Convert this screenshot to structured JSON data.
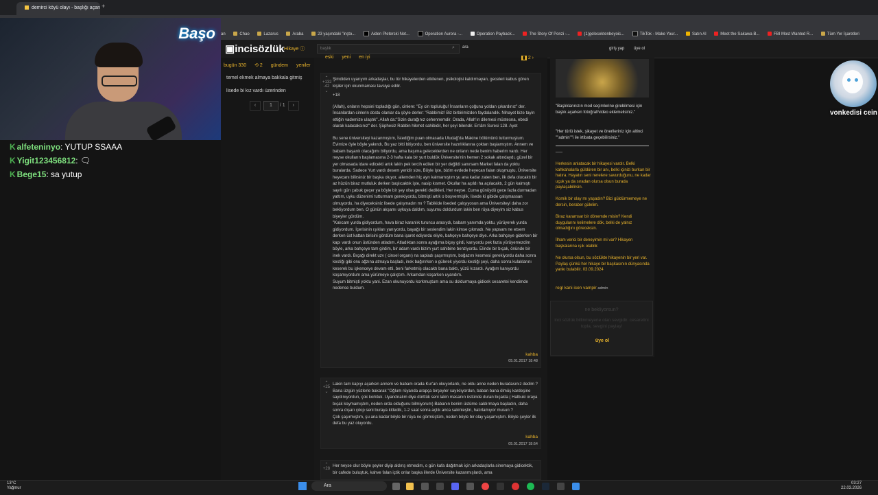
{
  "browser": {
    "tab_title": "demirci köyü olayı - başlığı açan",
    "new_tab": "+",
    "bookmarks": [
      "an",
      "Chao",
      "Lazarus",
      "Araba",
      "23 yaşındaki \"inşto...",
      "Aiden Pleterski Net...",
      "Operation Aurora -...",
      "Operation Payback...",
      "The Story Of Ponzi -...",
      "(1)gelecektenbeyoic...",
      "TikTok - Make Your...",
      "Satın Al",
      "Meet the Sakawa B...",
      "FBI Most Wanted R...",
      "Tüm Yer İşaretleri"
    ]
  },
  "stream": {
    "logo": "Başo",
    "chat": [
      {
        "user": "alfeteninyo",
        "message": "YUTUP SSAAA"
      },
      {
        "user": "Yigit123456812",
        "message": "🗨"
      },
      {
        "user": "Bege15",
        "message": "sa yutup"
      }
    ],
    "cat_name": "vonkedisi cein"
  },
  "site": {
    "logo": "incisözlük",
    "hikaye": "Hikaye",
    "search_placeholder": "başlık",
    "ara": "ara",
    "giris_yap": "giriş yap",
    "uye_ol": "üye ol",
    "nav": {
      "bugun": "bugün 330",
      "refresh": "⟲ 2",
      "gundem": "gündem",
      "yeniler": "yeniler"
    },
    "topics": [
      "temel ekmek almaya bakkala gitmiş",
      "lisede bi kız vardı üzerinden"
    ],
    "pager": {
      "prev": "‹",
      "page": "1",
      "of": "/ 1",
      "next": "›"
    },
    "sort_tabs": [
      "eski",
      "yeni",
      "en iyi"
    ],
    "page_indicator": "2"
  },
  "entries": [
    {
      "votes": "+132",
      "votes2": "-42",
      "paragraphs": [
        "Şimdiden uyarıyım arkadaşlar, bu tür hikayelerden etkilenen, psikolojisi kaldırmayan, geceleri kabus gören kişiler için okunmaması tavsiye edilir.",
        "+18",
        "(Allah), onların hepsini topladığı gün, cinlere: \"Ey cin topluluğu! İnsanların çoğunu yoldan çıkardınız\" der. İnsanlardan cinlerin dostu olanlar da şöyle derler: \"Rabbimiz! Biz birbirimizden faydalandık. Nihayet bize tayin ettiğin vademize ulaştık\". Allah da:\"Sizin durağınız cehennemdir. Orada, Allah'ın dilemesi müstesna, ebedi olarak kalacaksınız\" der. Şüphesiz Rabbin hikmet sahibidir, her şeyi bilendir. En'âm Suresi 128. Ayet",
        "Bu sene üniversiteyi kazanmıştım, İstediğim puan olmasada Uludağ'da Makine bölümünü tutturmuştum. Evimize öyle böyle yakındı, Bu yaz bitti bitiyordu, ben üniversite hazırlıklarına çoktan başlamıştım. Annem ve babam başarılı olacağımı biliyordu, ama başıma geleceklerden ne onların nede benim haberim vardı. Her neyse okulların başlamasına 2-3 hafta kala bir yurt buldük Üniversite'nin hemen 2 sokak altındaydı, güzel bir yer olmasada idare edicekti artık lakin pek tercih edilen bir yer değildi sanırsam Market falan da yoktu buralarda. Sadece Yurt vardı desem yeridir size, Böyle işte, bizim evdede heyecan falan oluşmuştu, Üniversite heyecanı bilirsiniz bir başka oluyor, ailemden hiç ayrı kalmamıştım şu ana kadar zaten ben, ilk defa olucaktı bir az hüzün biraz mutluluk derken başlıcaktık işte, nasip kısmet. Okullar ha açıldı ha açılacaktı, 2 gün kalmıştı sayılı gün çabuk geçer ya böyle bir şey olsa gerekti dedikleri, Her neyse. Cuma günüydü gece fazla durmadan yattım, uyku düzenimi tutturmam gerekiyordu, bitmişti artık o boşvermişlik, lisede ki gibide çalışmassan olmuyordu, ha diyeceksiniz lisede çalışmadın mı ? Tabikide liseded çalışıyosun ama Üniversiteyi daha zor bekliyordum ben. O günün akşamı uykuya daldım, suyumu doldurdum lakin ben rüya diyeyim siz kabus biyeyler gördüm.",
        "\"Kalıcam yurda gidiyordum, hava biraz karanlık turuncu arasıydı, babam yanımda yoktu, yürüyerek yurda gidiyordum. İçerisinin ışıkları yanıyordu, bayağı bir seslendim lakin kimse çıkmadı. Ne yapsam ne etsem derken üst kattan birisini gördüm bana işaret ediyordu eliyle, bahçeye bahçeye diye. Arka bahçeye giderken bir kapı vardı onun üstünden atladım. Atladıktan sonra ayağıma biçey girdi, karıyordu pek fazla yürüyemezdim böyle, arka bahçeye tam girdim, bir adam vardı bizim yurt sahibine benziyordu. Elinde bir bıçak, önünde bir inek vardı. Bıçağı direkt uzv ( cinsel organı) na sapladı şaşırmıştım, boğazını kesmesi gerekiyordu daha sonra kestiği gibi onu ağzına atmaya başladı, inek bağırırken o gülerek yiyordu kestiği şeyi, daha sonra kulaklarını keserek bu işkenceye devam etti, beni farketmiş olacaktı bana baktı, yüzü kızardı. Ayağım kanıyordu koşamıyordum ama yürümeye çalıştım. Arkamdan koşarken uyandım.",
        "Suyum bitmişti yoktu yani. Ezan okunuyordu korkmuştum ama su doldurmaya gidicek cesaretei kendimde nedense buldum."
      ],
      "author": "kahba",
      "date": "05.01.2017 18:48"
    },
    {
      "votes": "+25",
      "paragraphs": [
        "Lakin tam kapıyı açarken annem ve babam orada Kur'an okuyorlardı, ne oldu anne neden buradasınız dedim ? Bana üzgün yüzlerle bakarak \"Oğlum rüyanda arapça birşeyler sayıklıyordun, baban bana ölmüş kardeşine saydınıyordun, çok korktuk. Uyandıralım diye dürttük seni lakin masanın üstünde duran bıçakla ( Halbuki oraya bıçak koymamıştım, neden orda olduğunu bilmiyorum) Babanın benim üstüme saldırmaya başladın, daha sonra dışarı çıkıp seni buraya kitledik, 1-2 saat sonra açtık anca sakinleştin, hatırlamıyor musun ?",
        "Çok şaşırmıştım, şu ana kadar böyle bir rüya ne görmüştüm, neden böyle bir olay yaşamıştım. Böyle şeyler ilk defa bu yaz oluyordu."
      ],
      "author": "kahba",
      "date": "05.01.2017 18:54"
    },
    {
      "votes": "+28",
      "paragraphs": [
        "Her neyse olur böyle şeyler diyip aldırış etmedim, o gün kafa dağıtmak için arkadaşlarla sinemaya gidicektik, bir cafede buluştuk, kahve falan içtik onlar başka illerde Üniversite kazanmışlardı, ama"
      ]
    }
  ],
  "sidebar": {
    "p1": "\"Başlıklarınızın mod seçimlerine girebilmesi için başlık açarken fotoğraf/video eklemelisiniz.\"",
    "p2": "\"Her türlü istek, şikayet ve önerileriniz için altinci \"\"admin\"\"i ile irtibata geçebilirsiniz.\"",
    "dash": "___",
    "y1": "Herkesin anlatacak bir hikayesi vardır. Belki kahkahalarla güldüren bir anı, belki içinizi burkan bir hatıra. Hayatın seni nerelere savurduğunu, ne kadar uçuk ya da sıradan olursa olsun burada paylaşabilirsin.",
    "y2": "Komik bir olay mı yaşadın? Bizi güldürmemeye ne dersin, beraber gülelim.",
    "y3": "Biraz karamsar bir dönemde misin? Kendi duygularını kelimelere dök, belki de yalnız olmadığını göreceksin.",
    "y4": "İlham verici bir deneyimin mi var? Hikayen başkalarına ışık olabilir.",
    "y5": "Ne olursa olsun, bu sözlükte hikayenin bir yeri var. Paylaş çünkü her hikaye bir başkasının dünyasında yankı bulabilir. 03.09.2024",
    "regl": "regl kani icen vampir",
    "admin": "admin",
    "signup_title": "ne bekliyorsun?",
    "signup_desc": "inci sözlük billinmeyene olan sevgidir. cesaretini topla, sevgini paylaş!",
    "signup_btn": "üye ol"
  },
  "taskbar": {
    "temp": "13°C",
    "weather": "Yağmur",
    "search": "Ara",
    "time": "03:27",
    "date": "22.03.2026"
  }
}
